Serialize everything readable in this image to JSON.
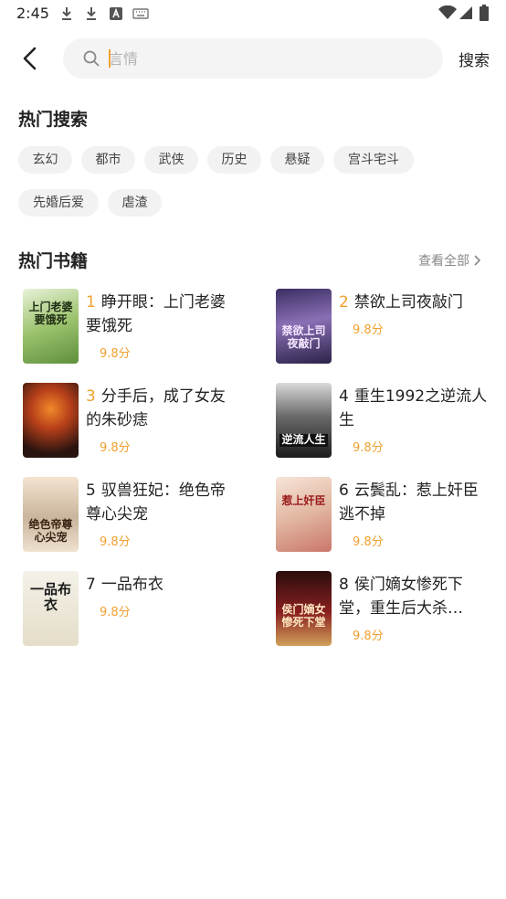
{
  "status_bar": {
    "time": "2:45"
  },
  "search": {
    "placeholder": "言情",
    "button_label": "搜索"
  },
  "hot_search": {
    "title": "热门搜索",
    "tags": [
      "玄幻",
      "都市",
      "武侠",
      "历史",
      "悬疑",
      "宫斗宅斗",
      "先婚后爱",
      "虐渣"
    ]
  },
  "hot_books": {
    "title": "热门书籍",
    "view_all_label": "查看全部",
    "books": [
      {
        "rank": "1",
        "title": "睁开眼：上门老婆要饿死",
        "score": "9.8分",
        "cover_text": "上门老婆要饿死"
      },
      {
        "rank": "2",
        "title": "禁欲上司夜敲门",
        "score": "9.8分",
        "cover_text": "禁欲上司夜敲门"
      },
      {
        "rank": "3",
        "title": "分手后，成了女友的朱砂痣",
        "score": "9.8分",
        "cover_text": ""
      },
      {
        "rank": "4",
        "title": "重生1992之逆流人生",
        "score": "9.8分",
        "cover_text": "逆流人生"
      },
      {
        "rank": "5",
        "title": "驭兽狂妃：绝色帝尊心尖宠",
        "score": "9.8分",
        "cover_text": "绝色帝尊心尖宠"
      },
      {
        "rank": "6",
        "title": "云鬓乱：惹上奸臣逃不掉",
        "score": "9.8分",
        "cover_text": "惹上奸臣"
      },
      {
        "rank": "7",
        "title": "一品布衣",
        "score": "9.8分",
        "cover_text": "一品布衣"
      },
      {
        "rank": "8",
        "title": "侯门嫡女惨死下堂，重生后大杀…",
        "score": "9.8分",
        "cover_text": "侯门嫡女惨死下堂"
      }
    ]
  },
  "colors": {
    "accent": "#f0a031",
    "tag_bg": "#f2f2f2",
    "search_bg": "#f4f4f4"
  },
  "icons": [
    "download-icon",
    "download-icon",
    "a-icon",
    "keyboard-icon",
    "wifi-icon",
    "signal-icon",
    "battery-icon",
    "back-icon",
    "search-icon",
    "chevron-right-icon"
  ]
}
